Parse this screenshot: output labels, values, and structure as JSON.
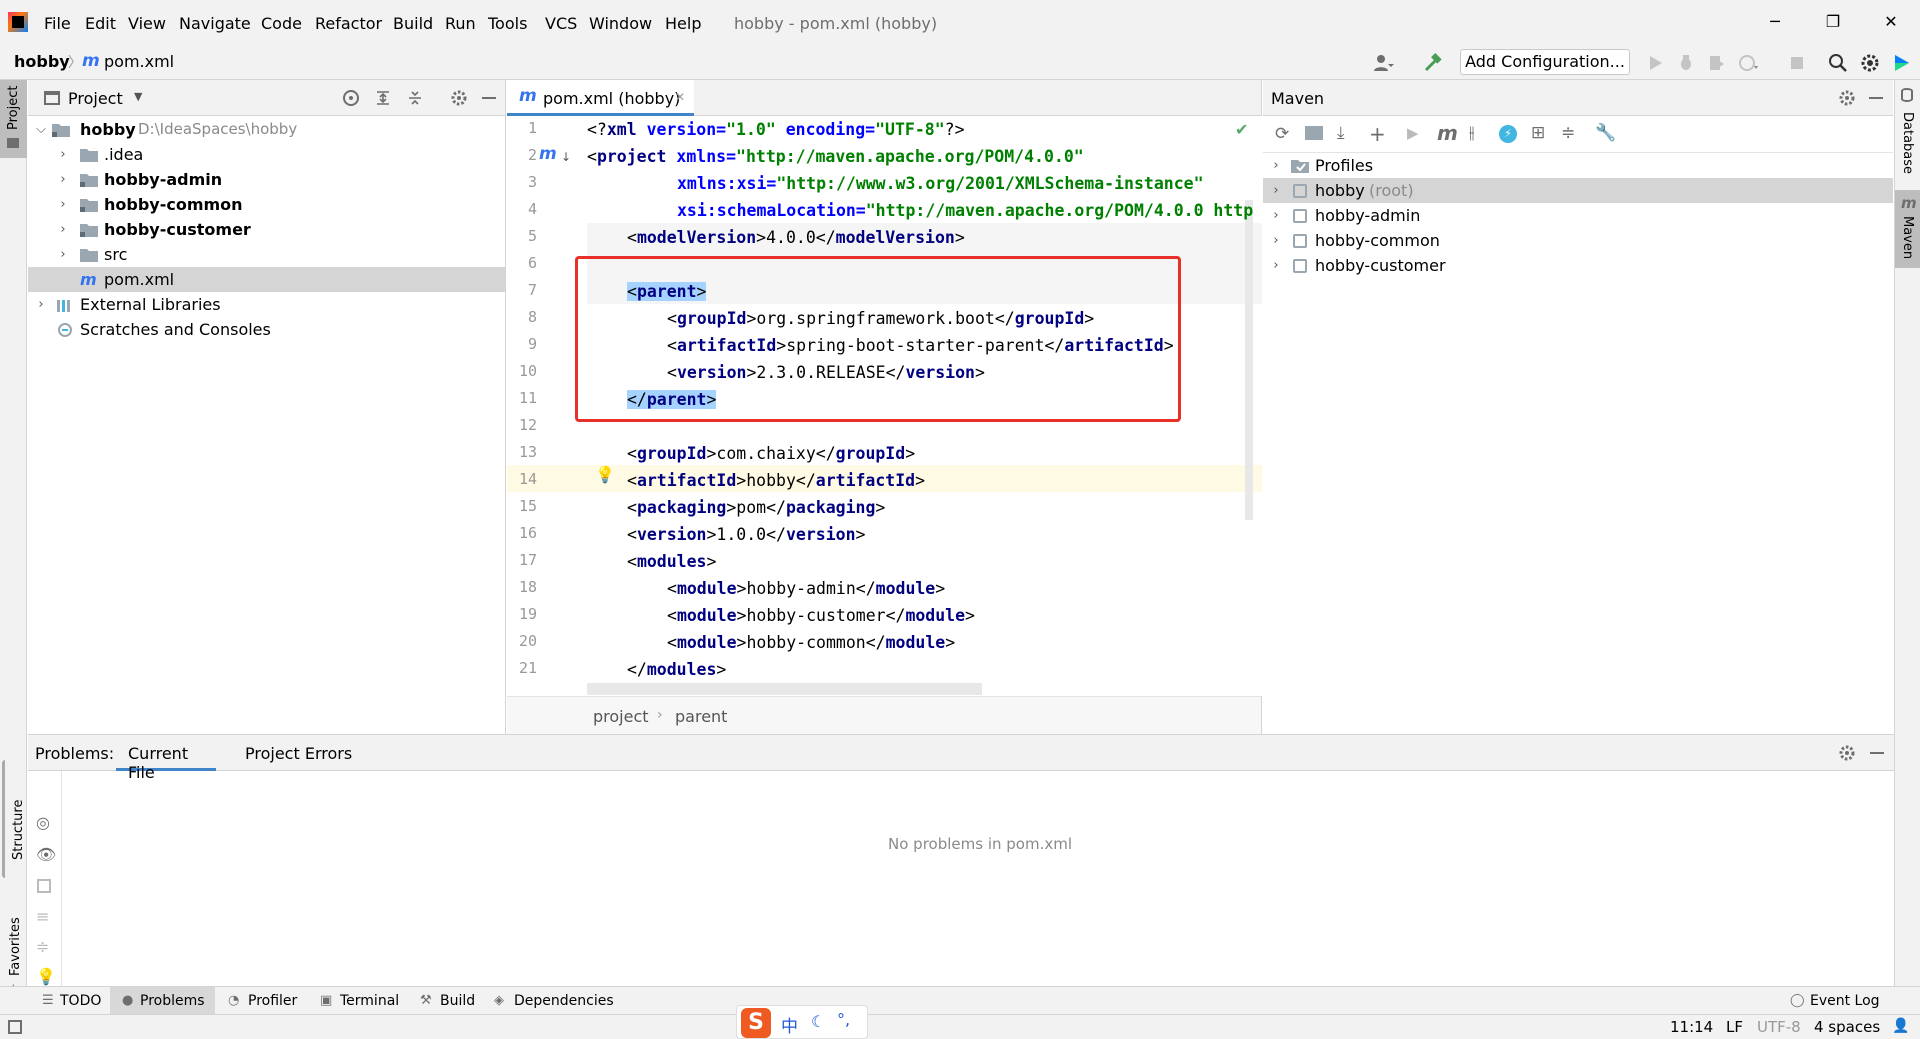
{
  "titlebar": {
    "menu": [
      "File",
      "Edit",
      "View",
      "Navigate",
      "Code",
      "Refactor",
      "Build",
      "Run",
      "Tools",
      "VCS",
      "Window",
      "Help"
    ],
    "window_title": "hobby - pom.xml (hobby)",
    "minimize": "─",
    "maximize": "❐",
    "close": "✕"
  },
  "navbar": {
    "breadcrumb_project": "hobby",
    "breadcrumb_file": "pom.xml",
    "add_configuration": "Add Configuration..."
  },
  "left_stripe": {
    "project": "Project",
    "structure": "Structure",
    "favorites": "Favorites"
  },
  "right_stripe": {
    "database": "Database",
    "maven": "Maven"
  },
  "project_panel": {
    "title": "Project",
    "tree": [
      {
        "label": "hobby",
        "extra": "D:\\IdeaSpaces\\hobby",
        "bold": true,
        "expanded": true
      },
      {
        "label": ".idea",
        "bold": false
      },
      {
        "label": "hobby-admin",
        "bold": true
      },
      {
        "label": "hobby-common",
        "bold": true
      },
      {
        "label": "hobby-customer",
        "bold": true
      },
      {
        "label": "src",
        "bold": false
      },
      {
        "label": "pom.xml",
        "bold": false,
        "selected": true
      },
      {
        "label": "External Libraries",
        "bold": false
      },
      {
        "label": "Scratches and Consoles",
        "bold": false
      }
    ]
  },
  "editor": {
    "tab_label": "pom.xml (hobby)",
    "breadcrumb": [
      "project",
      "parent"
    ],
    "line_numbers": [
      "1",
      "2",
      "3",
      "4",
      "5",
      "6",
      "7",
      "8",
      "9",
      "10",
      "11",
      "12",
      "13",
      "14",
      "15",
      "16",
      "17",
      "18",
      "19",
      "20",
      "21"
    ],
    "lines": {
      "l1_open": "<?",
      "l1_tag": "xml",
      "l1_a1": " version=",
      "l1_v1": "\"1.0\"",
      "l1_a2": " encoding=",
      "l1_v2": "\"UTF-8\"",
      "l1_close": "?>",
      "l2_open": "<",
      "l2_tag": "project",
      "l2_a": " xmlns=",
      "l2_v": "\"http://maven.apache.org/POM/4.0.0\"",
      "l3_a": "xmlns:xsi=",
      "l3_v": "\"http://www.w3.org/2001/XMLSchema-instance\"",
      "l4_a": "xsi:schemaLocation=",
      "l4_v": "\"http://maven.apache.org/POM/4.0.0 http",
      "l5": [
        "modelVersion",
        "4.0.0"
      ],
      "l7": "parent",
      "l8": [
        "groupId",
        "org.springframework.boot"
      ],
      "l9": [
        "artifactId",
        "spring-boot-starter-parent"
      ],
      "l10": [
        "version",
        "2.3.0.RELEASE"
      ],
      "l11": "parent",
      "l13": [
        "groupId",
        "com.chaixy"
      ],
      "l14": [
        "artifactId",
        "hobby"
      ],
      "l15": [
        "packaging",
        "pom"
      ],
      "l16": [
        "version",
        "1.0.0"
      ],
      "l17": "modules",
      "l18": [
        "module",
        "hobby-admin"
      ],
      "l19": [
        "module",
        "hobby-customer"
      ],
      "l20": [
        "module",
        "hobby-common"
      ],
      "l21": "modules"
    }
  },
  "maven": {
    "title": "Maven",
    "tree": [
      {
        "label": "Profiles",
        "extra": ""
      },
      {
        "label": "hobby",
        "extra": "(root)",
        "selected": true
      },
      {
        "label": "hobby-admin",
        "extra": ""
      },
      {
        "label": "hobby-common",
        "extra": ""
      },
      {
        "label": "hobby-customer",
        "extra": ""
      }
    ]
  },
  "problems": {
    "label": "Problems:",
    "tabs": [
      "Current File",
      "Project Errors"
    ],
    "empty_message": "No problems in pom.xml"
  },
  "tool_windows": [
    "TODO",
    "Problems",
    "Profiler",
    "Terminal",
    "Build",
    "Dependencies"
  ],
  "event_log": "Event Log",
  "statusbar": {
    "ime": "中",
    "position": "11:14",
    "line_sep": "LF",
    "encoding": "UTF-8",
    "indent": "4 spaces"
  },
  "colors": {
    "accent": "#3574f0",
    "highlight_box": "#e8302a",
    "tag": "#000080",
    "string": "#008000"
  }
}
